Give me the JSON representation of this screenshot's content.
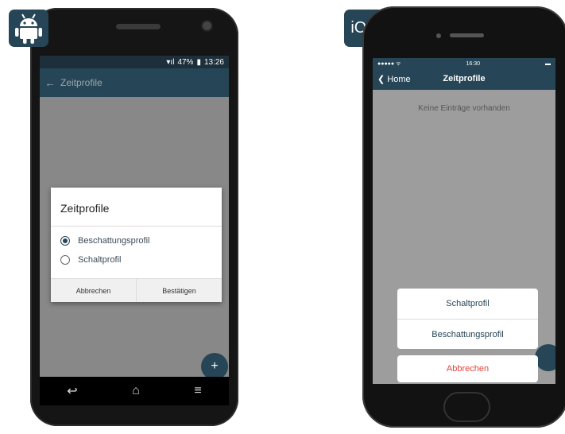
{
  "android": {
    "status": {
      "battery": "47%",
      "time": "13:26"
    },
    "app_title": "Zeitprofile",
    "dialog": {
      "title": "Zeitprofile",
      "options": [
        {
          "label": "Beschattungsprofil",
          "selected": true
        },
        {
          "label": "Schaltprofil",
          "selected": false
        }
      ],
      "cancel_label": "Abbrechen",
      "confirm_label": "Bestätigen"
    },
    "icons": {
      "back": "back-arrow-icon",
      "fab": "plus-icon",
      "nav": [
        "back-icon",
        "home-icon",
        "menu-icon"
      ]
    }
  },
  "ios": {
    "badge_label": "iOS",
    "status": {
      "time": "16:30"
    },
    "nav": {
      "back_label": "Home",
      "title": "Zeitprofile"
    },
    "empty_text": "Keine Einträge vorhanden",
    "action_sheet": {
      "items": [
        "Schaltprofil",
        "Beschattungsprofil"
      ],
      "cancel_label": "Abbrechen"
    }
  },
  "colors": {
    "primary": "#264556",
    "cancel": "#e0453b"
  }
}
